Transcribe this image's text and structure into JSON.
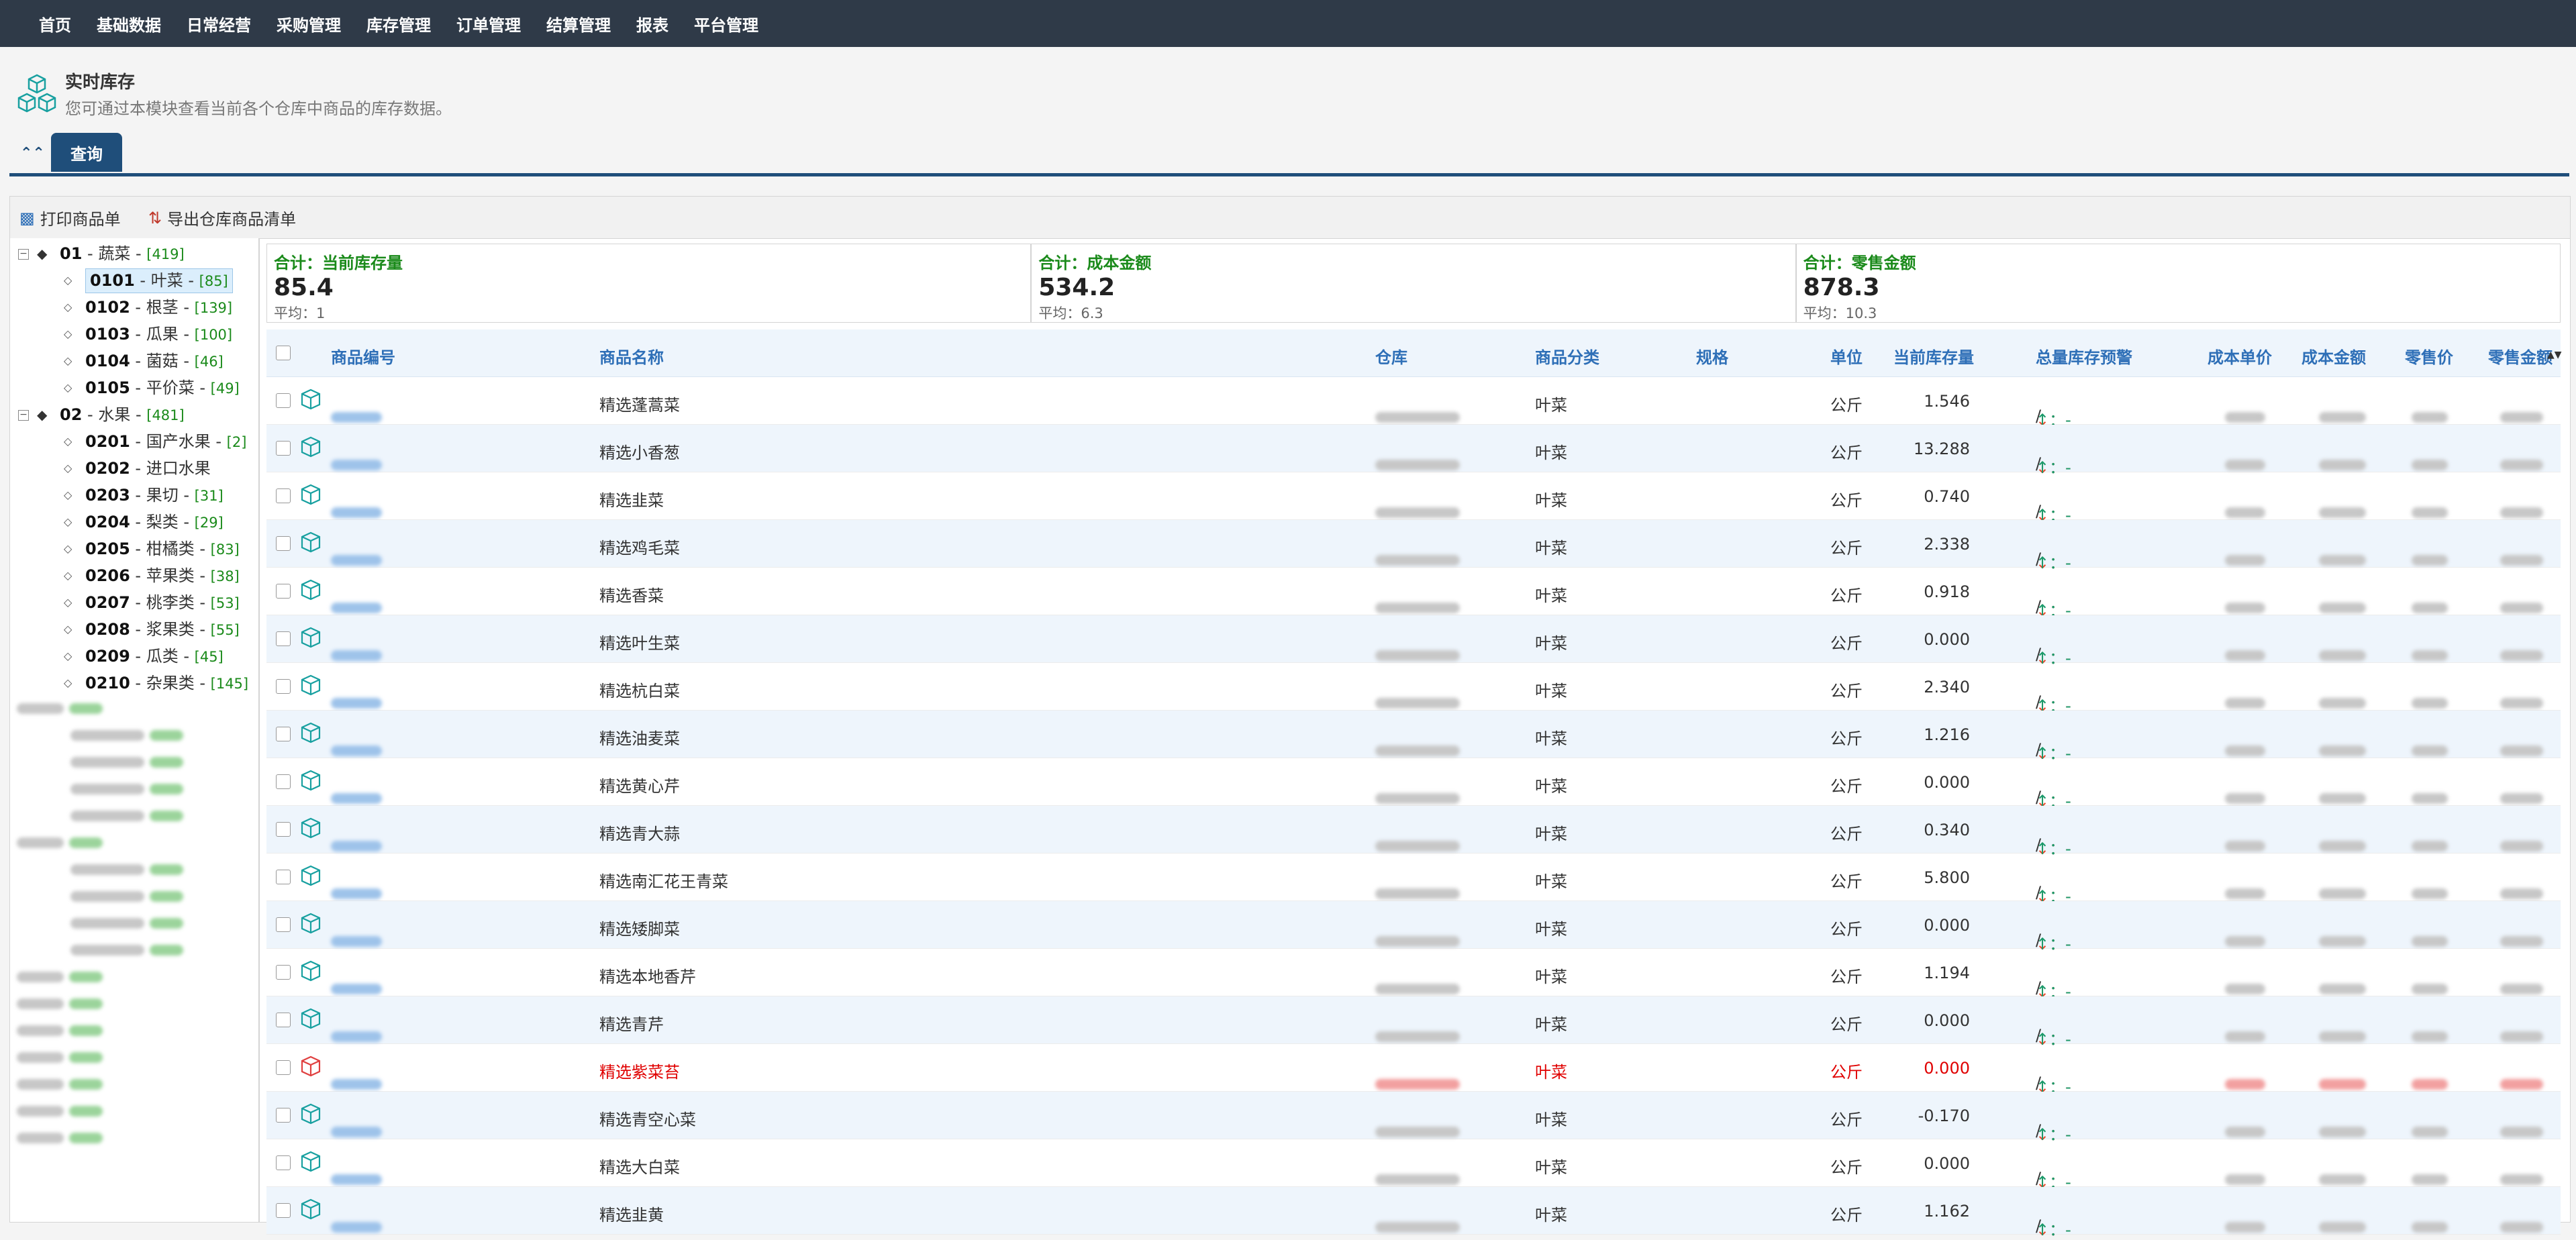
{
  "nav": [
    "首页",
    "基础数据",
    "日常经营",
    "采购管理",
    "库存管理",
    "订单管理",
    "结算管理",
    "报表",
    "平台管理"
  ],
  "page": {
    "title": "实时库存",
    "subtitle": "您可通过本模块查看当前各个仓库中商品的库存数据。"
  },
  "tab": {
    "collapse": "≈",
    "label": "查询"
  },
  "toolbar": {
    "print": "打印商品单",
    "export": "导出仓库商品清单"
  },
  "tree": [
    {
      "code": "01",
      "name": "蔬菜",
      "count": "[419]",
      "level": 0
    },
    {
      "code": "0101",
      "name": "叶菜",
      "count": "[85]",
      "level": 1,
      "selected": true
    },
    {
      "code": "0102",
      "name": "根茎",
      "count": "[139]",
      "level": 1
    },
    {
      "code": "0103",
      "name": "瓜果",
      "count": "[100]",
      "level": 1
    },
    {
      "code": "0104",
      "name": "菌菇",
      "count": "[46]",
      "level": 1
    },
    {
      "code": "0105",
      "name": "平价菜",
      "count": "[49]",
      "level": 1
    },
    {
      "code": "02",
      "name": "水果",
      "count": "[481]",
      "level": 0
    },
    {
      "code": "0201",
      "name": "国产水果",
      "count": "[2]",
      "level": 1
    },
    {
      "code": "0202",
      "name": "进口水果",
      "count": "",
      "level": 1
    },
    {
      "code": "0203",
      "name": "果切",
      "count": "[31]",
      "level": 1
    },
    {
      "code": "0204",
      "name": "梨类",
      "count": "[29]",
      "level": 1
    },
    {
      "code": "0205",
      "name": "柑橘类",
      "count": "[83]",
      "level": 1
    },
    {
      "code": "0206",
      "name": "苹果类",
      "count": "[38]",
      "level": 1
    },
    {
      "code": "0207",
      "name": "桃李类",
      "count": "[53]",
      "level": 1
    },
    {
      "code": "0208",
      "name": "浆果类",
      "count": "[55]",
      "level": 1
    },
    {
      "code": "0209",
      "name": "瓜类",
      "count": "[45]",
      "level": 1
    },
    {
      "code": "0210",
      "name": "杂果类",
      "count": "[145]",
      "level": 1
    }
  ],
  "summary": [
    {
      "label": "合计：当前库存量",
      "value": "85.4",
      "avg": "平均：1"
    },
    {
      "label": "合计：成本金额",
      "value": "534.2",
      "avg": "平均：6.3"
    },
    {
      "label": "合计：零售金额",
      "value": "878.3",
      "avg": "平均：10.3"
    }
  ],
  "columns": {
    "code": "商品编号",
    "name": "商品名称",
    "warehouse": "仓库",
    "category": "商品分类",
    "spec": "规格",
    "unit": "单位",
    "stock": "当前库存量",
    "alert": "总量库存预警",
    "cost_price": "成本单价",
    "cost_amount": "成本金额",
    "retail_price": "零售价",
    "retail_amount": "零售金额"
  },
  "alert_text": {
    "down": "↓：-",
    "sep": " / ",
    "up": "↑：-"
  },
  "rows": [
    {
      "name": "精选蓬蒿菜",
      "category": "叶菜",
      "unit": "公斤",
      "stock": "1.546"
    },
    {
      "name": "精选小香葱",
      "category": "叶菜",
      "unit": "公斤",
      "stock": "13.288"
    },
    {
      "name": "精选韭菜",
      "category": "叶菜",
      "unit": "公斤",
      "stock": "0.740"
    },
    {
      "name": "精选鸡毛菜",
      "category": "叶菜",
      "unit": "公斤",
      "stock": "2.338"
    },
    {
      "name": "精选香菜",
      "category": "叶菜",
      "unit": "公斤",
      "stock": "0.918"
    },
    {
      "name": "精选叶生菜",
      "category": "叶菜",
      "unit": "公斤",
      "stock": "0.000"
    },
    {
      "name": "精选杭白菜",
      "category": "叶菜",
      "unit": "公斤",
      "stock": "2.340"
    },
    {
      "name": "精选油麦菜",
      "category": "叶菜",
      "unit": "公斤",
      "stock": "1.216"
    },
    {
      "name": "精选黄心芹",
      "category": "叶菜",
      "unit": "公斤",
      "stock": "0.000"
    },
    {
      "name": "精选青大蒜",
      "category": "叶菜",
      "unit": "公斤",
      "stock": "0.340"
    },
    {
      "name": "精选南汇花王青菜",
      "category": "叶菜",
      "unit": "公斤",
      "stock": "5.800"
    },
    {
      "name": "精选矮脚菜",
      "category": "叶菜",
      "unit": "公斤",
      "stock": "0.000"
    },
    {
      "name": "精选本地香芹",
      "category": "叶菜",
      "unit": "公斤",
      "stock": "1.194"
    },
    {
      "name": "精选青芹",
      "category": "叶菜",
      "unit": "公斤",
      "stock": "0.000"
    },
    {
      "name": "精选紫菜苔",
      "category": "叶菜",
      "unit": "公斤",
      "stock": "0.000",
      "alert_row": true
    },
    {
      "name": "精选青空心菜",
      "category": "叶菜",
      "unit": "公斤",
      "stock": "-0.170"
    },
    {
      "name": "精选大白菜",
      "category": "叶菜",
      "unit": "公斤",
      "stock": "0.000"
    },
    {
      "name": "精选韭黄",
      "category": "叶菜",
      "unit": "公斤",
      "stock": "1.162"
    }
  ]
}
